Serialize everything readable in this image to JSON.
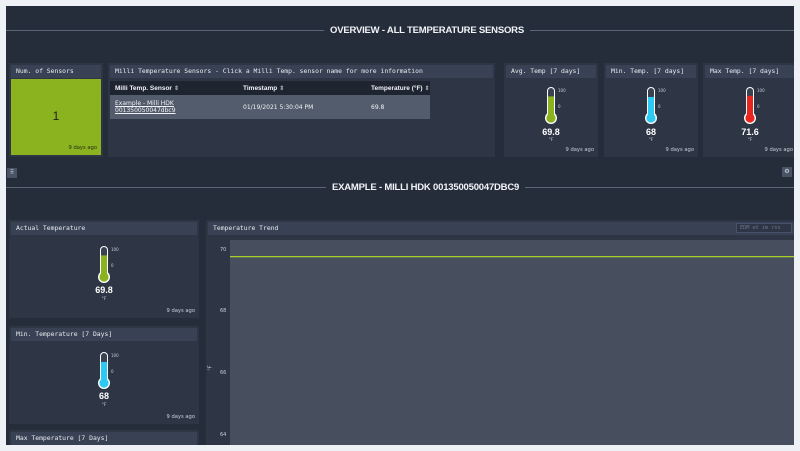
{
  "overview_header": {
    "title": "OVERVIEW - ALL TEMPERATURE SENSORS"
  },
  "num_sensors": {
    "title": "Num. of Sensors",
    "value": "1",
    "ago": "9 days ago",
    "color": "#8bb21f"
  },
  "sensor_table": {
    "title": "Milli Temperature Sensors - Click a Milli Temp. sensor name for more information",
    "columns": [
      "Milli Temp. Sensor",
      "Timestamp",
      "Temperature (°F)"
    ],
    "rows": [
      {
        "name_line1": "Example - Milli HDK",
        "name_line2": "001350050047dbc9",
        "timestamp": "01/19/2021 5:30:04 PM",
        "temperature": "69.8"
      }
    ]
  },
  "avg_temp": {
    "title": "Avg. Temp [7 days]",
    "value": "69.8",
    "unit": "°F",
    "ago": "9 days ago",
    "color": "#8bb21f",
    "fill_fraction": 0.7
  },
  "min_temp": {
    "title": "Min. Temp. [7 days]",
    "value": "68",
    "unit": "°F",
    "ago": "9 days ago",
    "color": "#2ec9f2",
    "fill_fraction": 0.68
  },
  "max_temp": {
    "title": "Max Temp. [7 days]",
    "value": "71.6",
    "unit": "°F",
    "ago": "9 days ago",
    "color": "#e8261f",
    "fill_fraction": 0.72
  },
  "scale": {
    "top": "100",
    "bottom": "0"
  },
  "detail_header": {
    "title": "EXAMPLE - MILLI HDK 001350050047DBC9"
  },
  "actual_temp": {
    "title": "Actual Temperature",
    "value": "69.8",
    "unit": "°F",
    "ago": "9 days ago",
    "color": "#8bb21f",
    "fill_fraction": 0.7
  },
  "min_temp_7": {
    "title": "Min. Temperature [7 Days]",
    "value": "68",
    "unit": "°F",
    "ago": "9 days ago",
    "color": "#2ec9f2",
    "fill_fraction": 0.68
  },
  "max_temp_7": {
    "title": "Max Temperature [7 Days]"
  },
  "trend": {
    "title": "Temperature Trend",
    "placeholder": "EDM et im rss",
    "ylabel": "°F",
    "yticks": [
      "70",
      "68",
      "66",
      "64"
    ]
  },
  "chart_data": {
    "type": "line",
    "title": "Temperature Trend",
    "ylabel": "°F",
    "ylim": [
      64,
      70
    ],
    "series": [
      {
        "values": [
          69.8,
          69.8
        ]
      }
    ],
    "line_color": "#a8d02a"
  }
}
